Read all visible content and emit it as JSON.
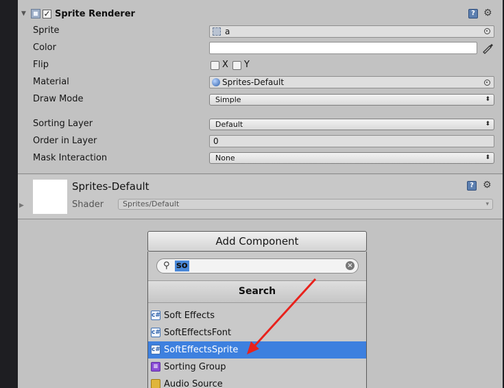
{
  "component": {
    "title": "Sprite Renderer",
    "enabled": true
  },
  "properties": {
    "sprite": {
      "label": "Sprite",
      "value": "a"
    },
    "color": {
      "label": "Color",
      "value": "#ffffff"
    },
    "flip": {
      "label": "Flip",
      "x_label": "X",
      "y_label": "Y"
    },
    "material": {
      "label": "Material",
      "value": "Sprites-Default"
    },
    "draw_mode": {
      "label": "Draw Mode",
      "value": "Simple"
    },
    "sorting_layer": {
      "label": "Sorting Layer",
      "value": "Default"
    },
    "order_in_layer": {
      "label": "Order in Layer",
      "value": "0"
    },
    "mask_interaction": {
      "label": "Mask Interaction",
      "value": "None"
    }
  },
  "material_section": {
    "name": "Sprites-Default",
    "shader_label": "Shader",
    "shader_value": "Sprites/Default"
  },
  "add_component": {
    "button_label": "Add Component",
    "search_value": "so",
    "search_header": "Search",
    "results": [
      {
        "label": "Soft Effects",
        "icon": "script-icon",
        "selected": false
      },
      {
        "label": "SoftEffectsFont",
        "icon": "script-icon",
        "selected": false
      },
      {
        "label": "SoftEffectsSprite",
        "icon": "script-icon",
        "selected": true
      },
      {
        "label": "Sorting Group",
        "icon": "sorting-group-icon",
        "selected": false
      },
      {
        "label": "Audio Source",
        "icon": "audio-icon",
        "selected": false
      }
    ]
  },
  "colors": {
    "panel_bg": "#c2c2c2",
    "selection": "#3d80df",
    "arrow": "#e8221c"
  }
}
